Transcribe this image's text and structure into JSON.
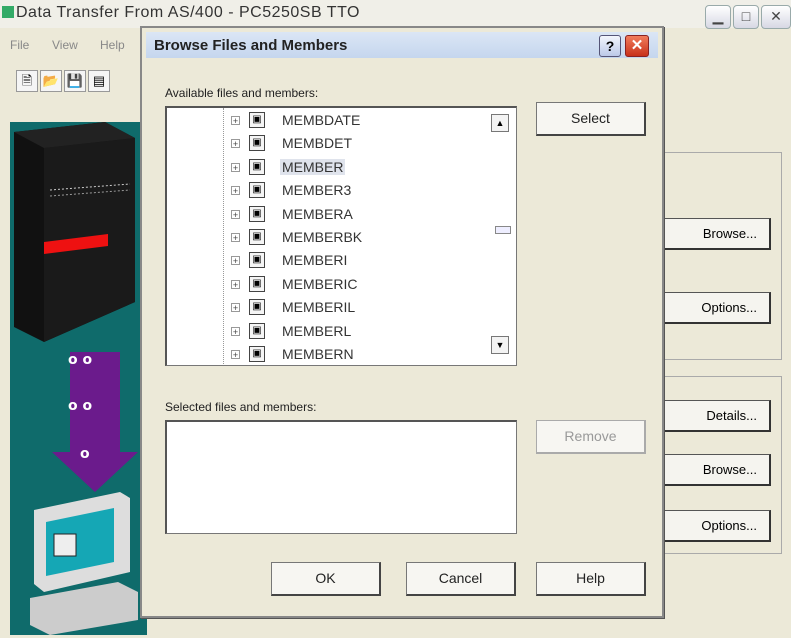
{
  "background_window": {
    "title": "Data Transfer From AS/400 - PC5250SB TTO",
    "menu": [
      "File",
      "View",
      "Help"
    ],
    "buttons": {
      "browse1": "Browse...",
      "options1": "Options...",
      "details": "Details...",
      "browse2": "Browse...",
      "options2": "Options..."
    }
  },
  "dialog": {
    "title": "Browse Files and Members",
    "help_label": "?",
    "close_label": "✕",
    "available_label": "Available files and members:",
    "members": [
      "MEMBDATE",
      "MEMBDET",
      "MEMBER",
      "MEMBER3",
      "MEMBERA",
      "MEMBERBK",
      "MEMBERI",
      "MEMBERIC",
      "MEMBERIL",
      "MEMBERL",
      "MEMBERN"
    ],
    "selected_member": "MEMBER",
    "selected_label": "Selected files and members:",
    "buttons": {
      "select": "Select",
      "remove": "Remove",
      "ok": "OK",
      "cancel": "Cancel",
      "help": "Help"
    }
  }
}
